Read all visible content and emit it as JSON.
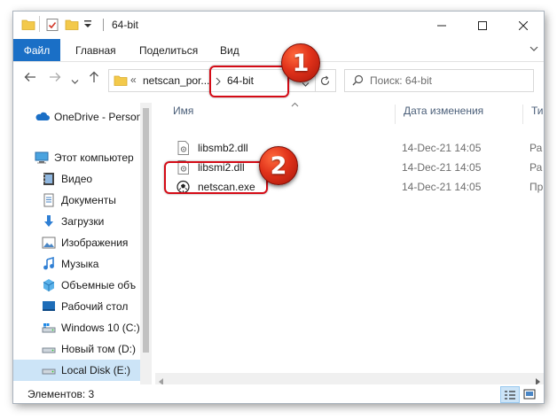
{
  "window": {
    "title": "64-bit"
  },
  "ribbon": {
    "tabs": [
      "Файл",
      "Главная",
      "Поделиться",
      "Вид"
    ]
  },
  "address": {
    "prefix": "«",
    "crumb1": "netscan_por...",
    "crumb2": "64-bit"
  },
  "search": {
    "placeholder": "Поиск: 64-bit"
  },
  "sidebar": {
    "items": [
      {
        "label": "OneDrive - Person",
        "icon": "cloud-icon"
      },
      {
        "label": "Этот компьютер",
        "icon": "computer-icon"
      },
      {
        "label": "Видео",
        "icon": "video-folder-icon"
      },
      {
        "label": "Документы",
        "icon": "documents-folder-icon"
      },
      {
        "label": "Загрузки",
        "icon": "downloads-arrow-icon"
      },
      {
        "label": "Изображения",
        "icon": "pictures-folder-icon"
      },
      {
        "label": "Музыка",
        "icon": "music-folder-icon"
      },
      {
        "label": "Объемные объ",
        "icon": "3d-objects-icon"
      },
      {
        "label": "Рабочий стол",
        "icon": "desktop-folder-icon"
      },
      {
        "label": "Windows 10 (C:)",
        "icon": "system-drive-icon"
      },
      {
        "label": "Новый том (D:)",
        "icon": "drive-icon"
      },
      {
        "label": "Local Disk (E:)",
        "icon": "drive-icon",
        "selected": true
      }
    ]
  },
  "columns": {
    "name": "Имя",
    "date": "Дата изменения",
    "type": "Ти"
  },
  "files": [
    {
      "name": "libsmb2.dll",
      "date": "14-Dec-21 14:05",
      "type": "Ра",
      "icon": "dll-file-icon"
    },
    {
      "name": "libsmi2.dll",
      "date": "14-Dec-21 14:05",
      "type": "Ра",
      "icon": "dll-file-icon"
    },
    {
      "name": "netscan.exe",
      "date": "14-Dec-21 14:05",
      "type": "Пр",
      "icon": "netscan-app-icon"
    }
  ],
  "status": {
    "items_count": "Элементов: 3"
  },
  "annotations": {
    "badge1": "1",
    "badge2": "2"
  },
  "colors": {
    "accent": "#1a6fc6",
    "selection": "#cce4f7",
    "annotation": "#d40b16"
  }
}
